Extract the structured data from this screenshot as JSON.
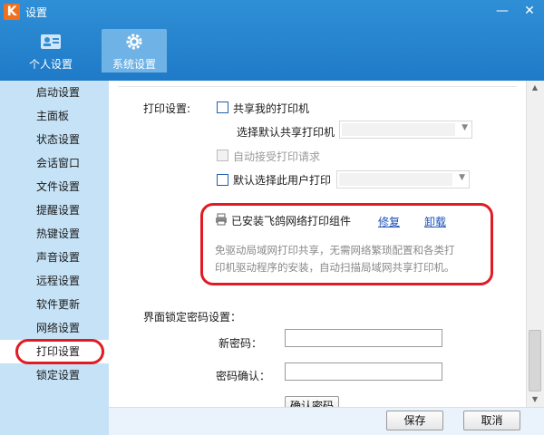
{
  "window": {
    "title": "设置",
    "logo_text": "K",
    "minimize_glyph": "—",
    "close_glyph": "✕"
  },
  "top_tabs": [
    {
      "label": "个人设置",
      "icon": "id-card-icon",
      "active": false
    },
    {
      "label": "系统设置",
      "icon": "gear-icon",
      "active": true
    }
  ],
  "sidebar": {
    "items": [
      {
        "label": "启动设置"
      },
      {
        "label": "主面板"
      },
      {
        "label": "状态设置"
      },
      {
        "label": "会话窗口"
      },
      {
        "label": "文件设置"
      },
      {
        "label": "提醒设置"
      },
      {
        "label": "热键设置"
      },
      {
        "label": "声音设置"
      },
      {
        "label": "远程设置"
      },
      {
        "label": "软件更新"
      },
      {
        "label": "网络设置"
      },
      {
        "label": "打印设置",
        "active": true
      },
      {
        "label": "锁定设置"
      }
    ]
  },
  "print": {
    "section_label": "打印设置:",
    "share_printer_label": "共享我的打印机",
    "share_printer_checked": false,
    "default_share_label": "选择默认共享打印机",
    "default_share_value": "",
    "auto_accept_label": "自动接受打印请求",
    "auto_accept_checked": false,
    "auto_accept_disabled": true,
    "default_user_print_label": "默认选择此用户打印",
    "default_user_print_checked": false,
    "default_user_print_value": "",
    "component_status": "已安装飞鸽网络打印组件",
    "repair_link": "修复",
    "uninstall_link": "卸载",
    "description_line1": "免驱动局域网打印共享，无需网络繁琐配置和各类打",
    "description_line2": "印机驱动程序的安装，自动扫描局域网共享打印机。"
  },
  "lock": {
    "section_label": "界面锁定密码设置：",
    "new_password_label": "新密码：",
    "new_password_value": "",
    "confirm_password_label": "密码确认：",
    "confirm_password_value": "",
    "confirm_button": "确认密码"
  },
  "footer": {
    "save_label": "保存",
    "cancel_label": "取消"
  },
  "colors": {
    "accent": "#1f7ac7",
    "sidebar_bg": "#c5e2f6",
    "annotation_red": "#e01b24",
    "link": "#1a4fb8"
  }
}
